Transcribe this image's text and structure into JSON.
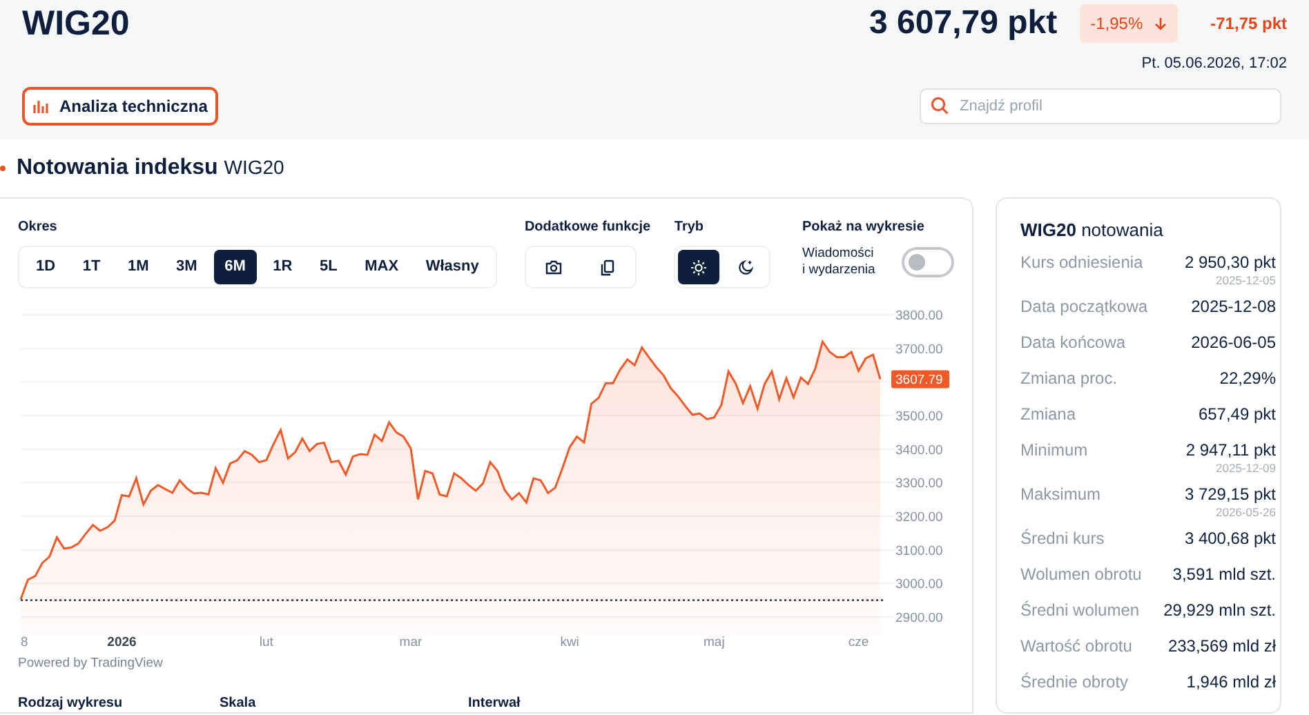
{
  "header": {
    "title": "WIG20",
    "price": "3 607,79 pkt",
    "change_percent": "-1,95%",
    "change_points": "-71,75 pkt",
    "timestamp": "Pt. 05.06.2026, 17:02",
    "tech_button": "Analiza techniczna",
    "search": {
      "placeholder": "Znajdź profil"
    }
  },
  "section_title": {
    "bold": "Notowania indeksu",
    "normal": "WIG20"
  },
  "controls": {
    "period_label": "Okres",
    "periods": [
      {
        "label": "1D",
        "selected": false
      },
      {
        "label": "1T",
        "selected": false
      },
      {
        "label": "1M",
        "selected": false
      },
      {
        "label": "3M",
        "selected": false
      },
      {
        "label": "6M",
        "selected": true
      },
      {
        "label": "1R",
        "selected": false
      },
      {
        "label": "5L",
        "selected": false
      },
      {
        "label": "MAX",
        "selected": false
      },
      {
        "label": "Własny",
        "selected": false
      }
    ],
    "functions_label": "Dodatkowe funkcje",
    "functions": [
      {
        "kind": "camera"
      },
      {
        "kind": "copy"
      }
    ],
    "mode_label": "Tryb",
    "modes": [
      {
        "kind": "light",
        "selected": true
      },
      {
        "kind": "dark",
        "selected": false
      }
    ],
    "show_label": "Pokaż na wykresie",
    "news_toggle": {
      "label": "Wiadomości i wydarzenia",
      "on": false
    }
  },
  "chart": {
    "chart_data": {
      "type": "area",
      "grid": true,
      "ylim": [
        2900,
        3800
      ],
      "categories": [
        "8",
        null,
        null,
        null,
        null,
        null,
        null,
        null,
        null,
        null,
        null,
        null,
        null,
        null,
        "2026",
        null,
        null,
        null,
        null,
        null,
        null,
        null,
        null,
        null,
        null,
        null,
        null,
        null,
        null,
        null,
        null,
        null,
        null,
        null,
        "lut",
        null,
        null,
        null,
        null,
        null,
        null,
        null,
        null,
        null,
        null,
        null,
        null,
        null,
        null,
        null,
        null,
        null,
        null,
        null,
        "mar",
        null,
        null,
        null,
        null,
        null,
        null,
        null,
        null,
        null,
        null,
        null,
        null,
        null,
        null,
        null,
        null,
        null,
        null,
        null,
        null,
        null,
        "kwi",
        null,
        null,
        null,
        null,
        null,
        null,
        null,
        null,
        null,
        null,
        null,
        null,
        null,
        null,
        null,
        null,
        null,
        null,
        null,
        "maj",
        null,
        null,
        null,
        null,
        null,
        null,
        null,
        null,
        null,
        null,
        null,
        null,
        null,
        null,
        null,
        null,
        null,
        null,
        null,
        "cze",
        null,
        null,
        null
      ],
      "series": [
        {
          "color": "#f05a28",
          "values": [
            2952,
            3011,
            3022,
            3061,
            3080,
            3137,
            3104,
            3107,
            3119,
            3148,
            3174,
            3157,
            3167,
            3187,
            3263,
            3259,
            3313,
            3235,
            3276,
            3293,
            3281,
            3270,
            3307,
            3283,
            3268,
            3270,
            3265,
            3343,
            3300,
            3357,
            3367,
            3394,
            3383,
            3361,
            3367,
            3415,
            3457,
            3372,
            3391,
            3431,
            3394,
            3415,
            3419,
            3361,
            3365,
            3324,
            3378,
            3385,
            3383,
            3443,
            3424,
            3480,
            3450,
            3437,
            3402,
            3250,
            3335,
            3328,
            3265,
            3259,
            3328,
            3313,
            3293,
            3276,
            3298,
            3361,
            3335,
            3278,
            3250,
            3269,
            3241,
            3313,
            3307,
            3269,
            3285,
            3343,
            3406,
            3437,
            3420,
            3535,
            3552,
            3596,
            3596,
            3637,
            3667,
            3650,
            3702,
            3672,
            3644,
            3619,
            3581,
            3557,
            3528,
            3502,
            3506,
            3489,
            3494,
            3531,
            3631,
            3594,
            3537,
            3587,
            3520,
            3594,
            3631,
            3548,
            3611,
            3554,
            3613,
            3594,
            3639,
            3720,
            3689,
            3674,
            3674,
            3689,
            3633,
            3670,
            3681,
            3608
          ]
        }
      ],
      "yticks": [
        {
          "value": 2900,
          "label": "2900.00"
        },
        {
          "value": 3000,
          "label": "3000.00"
        },
        {
          "value": 3100,
          "label": "3100.00"
        },
        {
          "value": 3200,
          "label": "3200.00"
        },
        {
          "value": 3300,
          "label": "3300.00"
        },
        {
          "value": 3400,
          "label": "3400.00"
        },
        {
          "value": 3500,
          "label": "3500.00"
        },
        {
          "value": 3700,
          "label": "3700.00"
        },
        {
          "value": 3800,
          "label": "3800.00"
        }
      ],
      "ref_lines": [
        {
          "axis": "y",
          "value": 2950
        }
      ],
      "annotations": [
        "3607.79"
      ]
    },
    "credit": "Powered by TradingView"
  },
  "bottom_labels": [
    "Rodzaj wykresu",
    "Skala",
    "Interwał"
  ],
  "stats": {
    "title_bold": "WIG20",
    "title": "notowania",
    "rows": [
      {
        "label": "Kurs odniesienia",
        "value": "2 950,30 pkt",
        "date": "2025-12-05"
      },
      {
        "label": "Data początkowa",
        "value": "2025-12-08"
      },
      {
        "label": "Data końcowa",
        "value": "2026-06-05"
      },
      {
        "label": "Zmiana proc.",
        "value": "22,29%"
      },
      {
        "label": "Zmiana",
        "value": "657,49 pkt"
      },
      {
        "label": "Minimum",
        "value": "2 947,11 pkt",
        "date": "2025-12-09"
      },
      {
        "label": "Maksimum",
        "value": "3 729,15 pkt",
        "date": "2026-05-26"
      },
      {
        "label": "Średni kurs",
        "value": "3 400,68 pkt"
      },
      {
        "label": "Wolumen obrotu",
        "value": "3,591 mld szt."
      },
      {
        "label": "Średni wolumen",
        "value": "29,929 mln szt."
      },
      {
        "label": "Wartość obrotu",
        "value": "233,569 mld zł"
      },
      {
        "label": "Średnie obroty",
        "value": "1,946 mld zł"
      }
    ]
  }
}
